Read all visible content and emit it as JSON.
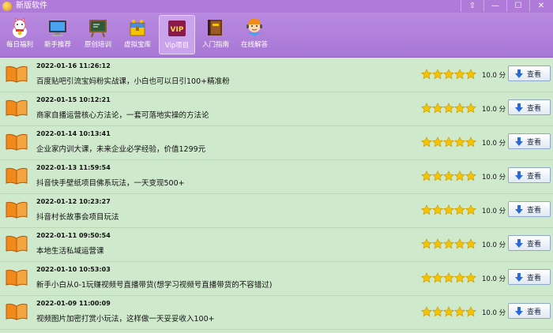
{
  "window": {
    "title": "新版软件",
    "buttons": [
      "⇧",
      "—",
      "☐",
      "✕"
    ]
  },
  "toolbar": {
    "items": [
      {
        "label": "每日福利",
        "icon": "lucky-cat-icon"
      },
      {
        "label": "新手推荐",
        "icon": "monitor-icon"
      },
      {
        "label": "原创培训",
        "icon": "blackboard-icon"
      },
      {
        "label": "虚拟宝库",
        "icon": "treasure-chest-icon"
      },
      {
        "label": "Vip项目",
        "icon": "vip-icon",
        "badge": "VIP",
        "active": true
      },
      {
        "label": "入门指南",
        "icon": "guide-book-icon"
      },
      {
        "label": "在线解答",
        "icon": "support-agent-icon"
      }
    ]
  },
  "list": {
    "rating_stars": 5,
    "view_label": "查看",
    "items": [
      {
        "date": "2022-01-16 11:26:12",
        "title": "百度贴吧引流宝妈粉实战课，小白也可以日引100+精准粉",
        "score": "10.0 分"
      },
      {
        "date": "2022-01-15 10:12:21",
        "title": "商家自播运营核心方法论，一套可落地实操的方法论",
        "score": "10.0 分"
      },
      {
        "date": "2022-01-14 10:13:41",
        "title": "企业家内训大课，未来企业必学经验，价值1299元",
        "score": "10.0 分"
      },
      {
        "date": "2022-01-13 11:59:54",
        "title": "抖音快手壁纸项目佛系玩法，一天变现500+",
        "score": "10.0 分"
      },
      {
        "date": "2022-01-12 10:23:27",
        "title": "抖音村长故事会项目玩法",
        "score": "10.0 分"
      },
      {
        "date": "2022-01-11 09:50:54",
        "title": "本地生活私域运营课",
        "score": "10.0 分"
      },
      {
        "date": "2022-01-10 10:53:03",
        "title": "新手小白从0-1玩赚视频号直播带货(想学习视频号直播带货的不容错过)",
        "score": "10.0 分"
      },
      {
        "date": "2022-01-09 11:00:09",
        "title": "视频图片加密打赏小玩法，这样做一天妥妥收入100+",
        "score": "10.0 分"
      }
    ]
  },
  "colors": {
    "titlebar": "#b07ad8",
    "toolbar": "#a877d6",
    "list_bg": "#cfe9cc",
    "star": "#f5c400",
    "book": "#f08a1c"
  }
}
